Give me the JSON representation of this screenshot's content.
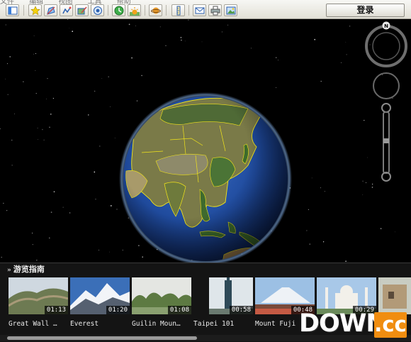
{
  "toolbar": {
    "menu_ghost": [
      "文件",
      "编辑",
      "视图",
      "工具",
      "帮助"
    ],
    "buttons": [
      {
        "name": "sidebar-toggle-button",
        "icon": "sidebar-icon"
      },
      {
        "name": "add-placemark-button",
        "icon": "pushpin-icon"
      },
      {
        "name": "add-polygon-button",
        "icon": "polygon-icon"
      },
      {
        "name": "add-path-button",
        "icon": "path-icon"
      },
      {
        "name": "image-overlay-button",
        "icon": "overlay-icon"
      },
      {
        "name": "record-tour-button",
        "icon": "record-icon"
      },
      {
        "name": "historical-imagery-button",
        "icon": "clock-icon"
      },
      {
        "name": "sunlight-button",
        "icon": "sun-icon"
      },
      {
        "name": "planets-button",
        "icon": "planet-icon"
      },
      {
        "name": "ruler-button",
        "icon": "ruler-icon"
      },
      {
        "name": "email-button",
        "icon": "envelope-icon"
      },
      {
        "name": "print-button",
        "icon": "printer-icon"
      },
      {
        "name": "save-image-button",
        "icon": "picture-icon"
      }
    ],
    "login_label": "登录"
  },
  "navigation": {
    "compass_north": "N"
  },
  "tour": {
    "header": "游览指南",
    "items": [
      {
        "caption": "Great Wall …",
        "duration": "01:13"
      },
      {
        "caption": "Everest",
        "duration": "01:20"
      },
      {
        "caption": "Guilin Moun…",
        "duration": "01:08"
      },
      {
        "caption": "Taipei 101",
        "duration": "00:58"
      },
      {
        "caption": "Mount Fuji",
        "duration": "00:48"
      },
      {
        "caption": "",
        "duration": "00:29"
      },
      {
        "caption": "",
        "duration": ""
      }
    ]
  },
  "watermark": {
    "text": "DOWN",
    "suffix": ".cc"
  },
  "colors": {
    "border_yellow": "#f2e51a",
    "ocean": "#1c3f8c",
    "watermark_orange": "#f08d10"
  }
}
